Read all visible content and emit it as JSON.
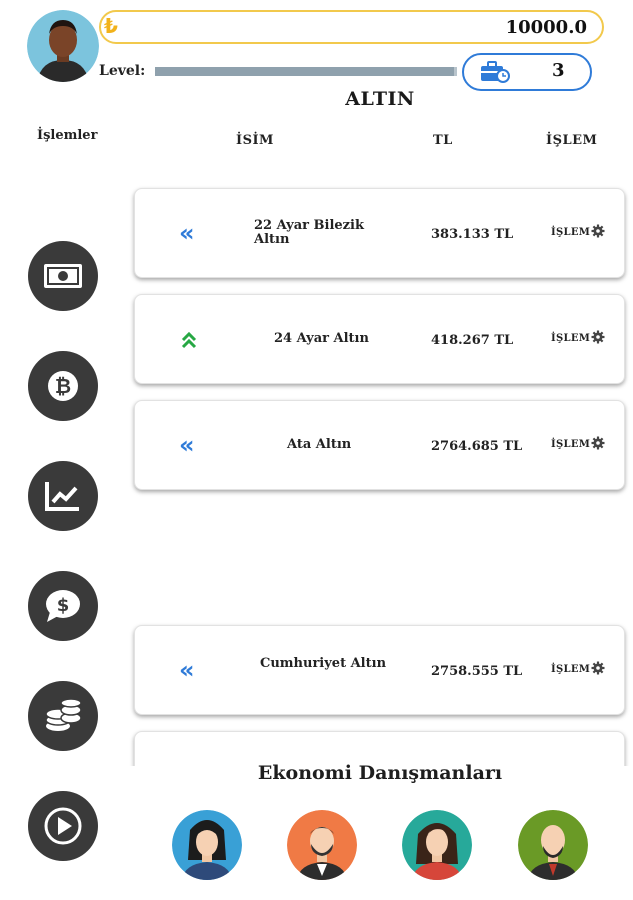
{
  "header": {
    "currency_symbol": "₺",
    "balance": "10000.0",
    "level_label": "Level:",
    "level_progress": 0.99,
    "cases_count": "3"
  },
  "page_title": "ALTIN",
  "side_title": "İşlemler",
  "columns": {
    "name": "İSİM",
    "price": "TL",
    "action": "İŞLEM"
  },
  "sidebar": [
    {
      "icon": "banknote-icon",
      "label": ""
    },
    {
      "icon": "bitcoin-icon",
      "label": ""
    },
    {
      "icon": "chart-icon",
      "label": ""
    },
    {
      "icon": "dollar-chat-icon",
      "label": ""
    },
    {
      "icon": "coins-icon",
      "label": ""
    },
    {
      "icon": "play-icon",
      "label": ""
    }
  ],
  "items": [
    {
      "name_line1": "22 Ayar Bilezik",
      "name_line2": "Altın",
      "price": "383.133 TL",
      "trend": "down",
      "action": "İŞLEM"
    },
    {
      "name_line1": "24 Ayar Altın",
      "name_line2": "",
      "price": "418.267 TL",
      "trend": "up",
      "action": "İŞLEM"
    },
    {
      "name_line1": "Ata Altın",
      "name_line2": "",
      "price": "2764.685 TL",
      "trend": "down",
      "action": "İŞLEM"
    },
    {
      "name_line1": "Cumhuriyet Altın",
      "name_line2": "",
      "price": "2758.555 TL",
      "trend": "down",
      "action": "İŞLEM"
    }
  ],
  "arrows": {
    "down": "«",
    "up": "⌃"
  },
  "colors": {
    "accent_gold": "#f2c94c",
    "accent_blue": "#2f7bd8",
    "trend_down": "#2f7bd8",
    "trend_up": "#27a844"
  },
  "advisors_title": "Ekonomi Danışmanları"
}
